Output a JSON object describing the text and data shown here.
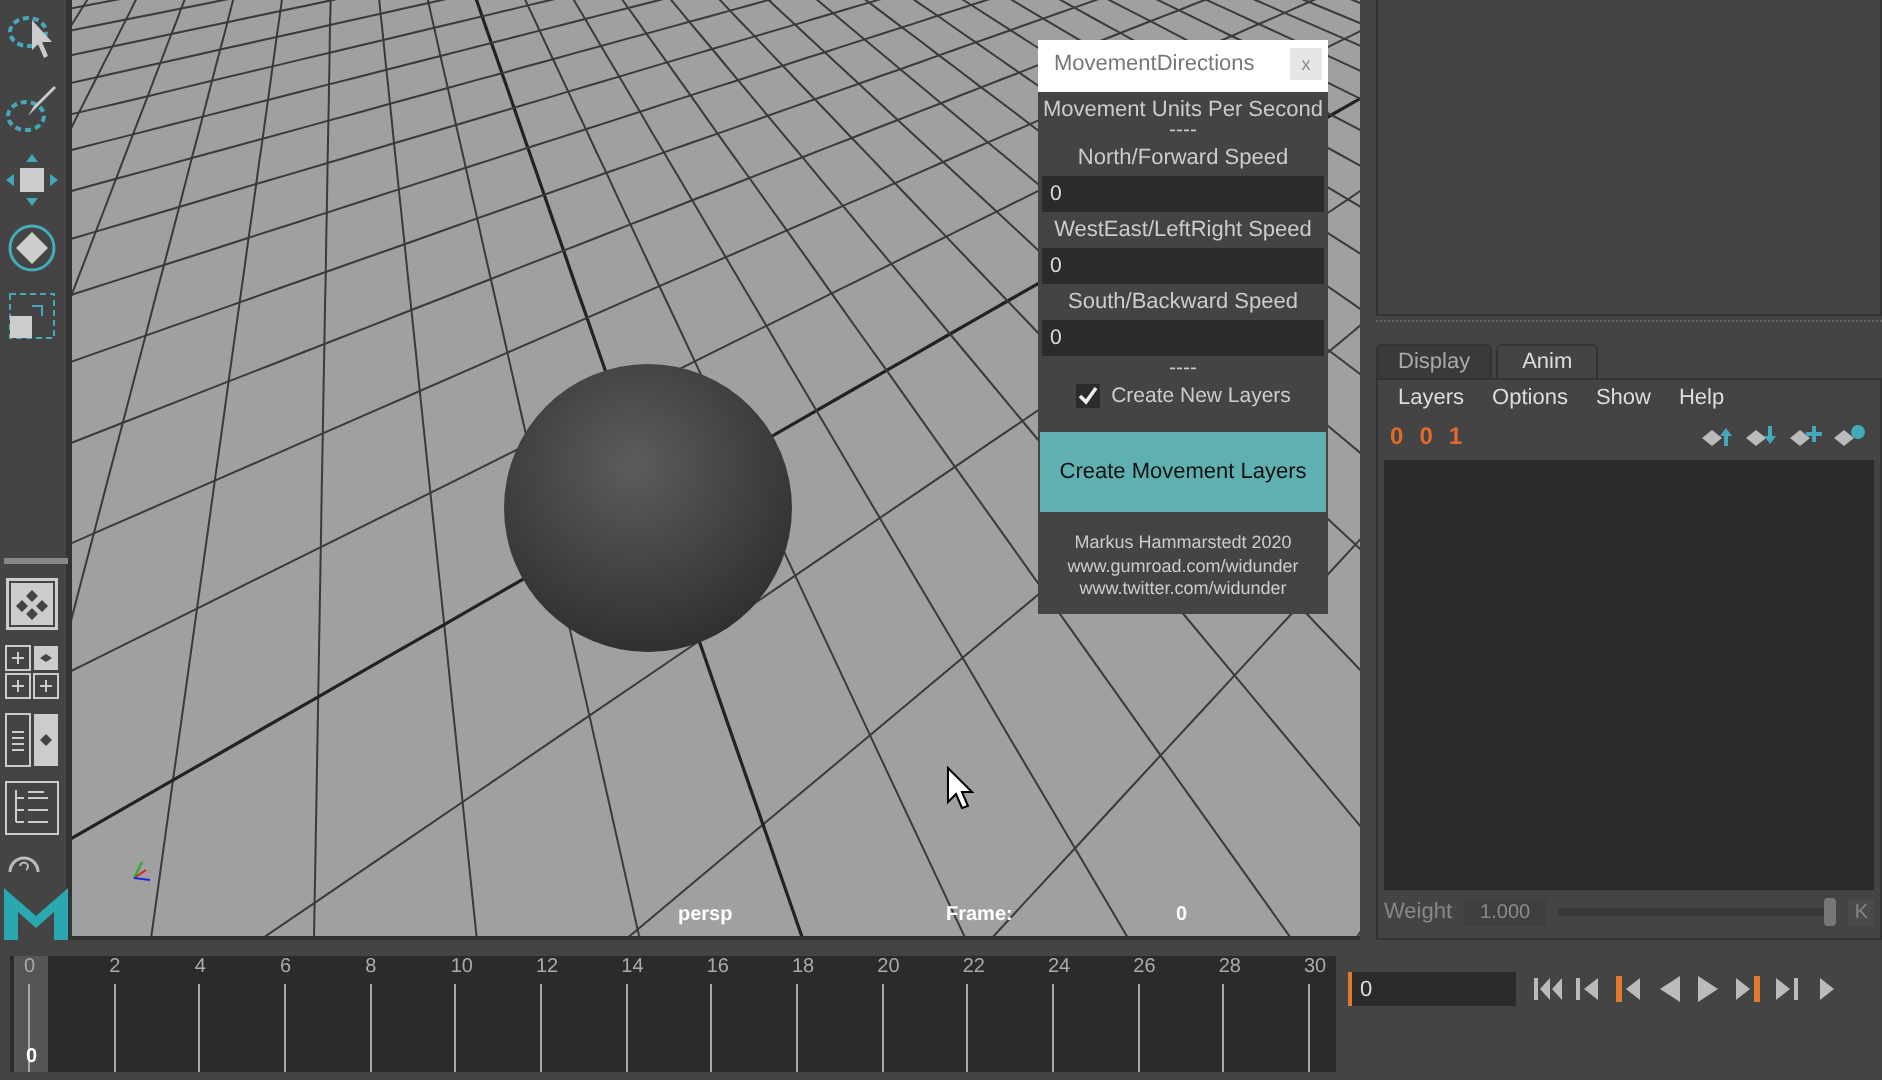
{
  "dialog": {
    "title": "MovementDirections",
    "close": "x",
    "heading": "Movement Units Per Second",
    "separator": "----",
    "fields": [
      {
        "label": "North/Forward Speed",
        "value": "0"
      },
      {
        "label": "WestEast/LeftRight Speed",
        "value": "0"
      },
      {
        "label": "South/Backward Speed",
        "value": "0"
      }
    ],
    "separator_2": "----",
    "checkbox": {
      "label": "Create New Layers",
      "checked": true
    },
    "button": "Create Movement Layers",
    "credits": [
      "Markus Hammarstedt 2020",
      "www.gumroad.com/widunder",
      "www.twitter.com/widunder"
    ]
  },
  "viewport": {
    "camera": "persp",
    "frame_label": "Frame:",
    "frame": "0"
  },
  "layer_editor": {
    "tabs": [
      {
        "label": "Display",
        "selected": false
      },
      {
        "label": "Anim",
        "selected": true
      }
    ],
    "menu": [
      "Layers",
      "Options",
      "Show",
      "Help"
    ],
    "layer_buttons": [
      "0",
      "0",
      "1"
    ],
    "weight": {
      "label": "Weight",
      "value": "1.000",
      "level": 1
    },
    "key_button": "K"
  },
  "timeline": {
    "ticks": [
      "0",
      "2",
      "4",
      "6",
      "8",
      "10",
      "12",
      "14",
      "16",
      "18",
      "20",
      "22",
      "24",
      "26",
      "28",
      "30"
    ],
    "current": "0",
    "level": 0
  },
  "playback": {
    "frame": "0"
  }
}
